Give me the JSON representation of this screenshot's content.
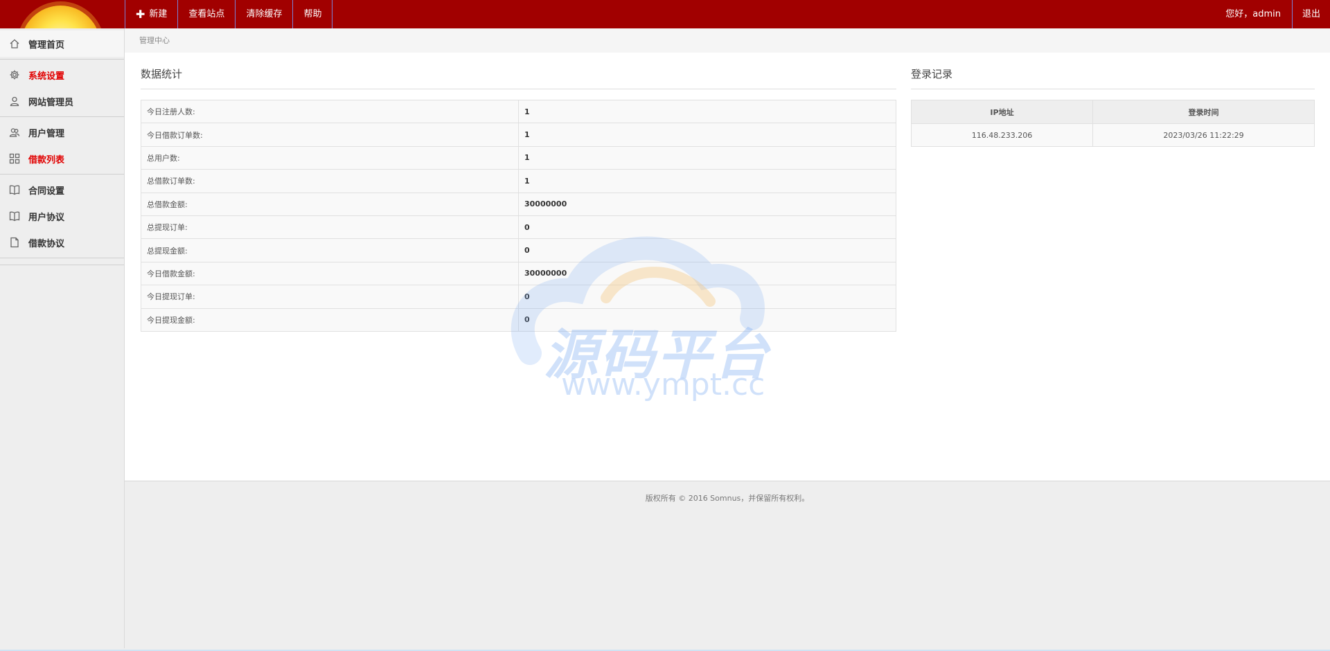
{
  "topnav": {
    "items": [
      {
        "label": "新建",
        "icon": "plus-icon"
      },
      {
        "label": "查看站点"
      },
      {
        "label": "清除缓存"
      },
      {
        "label": "帮助"
      }
    ],
    "greeting": "您好，",
    "username": "admin",
    "logout": "退出"
  },
  "sidebar": {
    "items": [
      {
        "label": "管理首页",
        "icon": "home-icon"
      },
      {
        "label": "系统设置",
        "icon": "gear-icon"
      },
      {
        "label": "网站管理员",
        "icon": "user-icon"
      },
      {
        "label": "用户管理",
        "icon": "users-icon"
      },
      {
        "label": "借款列表",
        "icon": "grid-icon"
      },
      {
        "label": "合同设置",
        "icon": "book-icon"
      },
      {
        "label": "用户协议",
        "icon": "book-icon"
      },
      {
        "label": "借款协议",
        "icon": "document-icon"
      }
    ]
  },
  "breadcrumb": "管理中心",
  "stats": {
    "title": "数据统计",
    "rows": [
      {
        "label": "今日注册人数:",
        "value": "1"
      },
      {
        "label": "今日借款订单数:",
        "value": "1"
      },
      {
        "label": "总用户数:",
        "value": "1"
      },
      {
        "label": "总借款订单数:",
        "value": "1"
      },
      {
        "label": "总借款金额:",
        "value": "30000000"
      },
      {
        "label": "总提现订单:",
        "value": "0"
      },
      {
        "label": "总提现金额:",
        "value": "0"
      },
      {
        "label": "今日借款金额:",
        "value": "30000000"
      },
      {
        "label": "今日提现订单:",
        "value": "0"
      },
      {
        "label": "今日提现金额:",
        "value": "0"
      }
    ]
  },
  "login": {
    "title": "登录记录",
    "headers": [
      "IP地址",
      "登录时间"
    ],
    "rows": [
      {
        "ip": "116.48.233.206",
        "time": "2023/03/26 11:22:29"
      }
    ]
  },
  "footer": "版权所有 © 2016 Somnus，并保留所有权利。",
  "watermark": {
    "text": "源码平台",
    "url": "www.ympt.cc"
  },
  "colors": {
    "topbar": "#a10000",
    "active": "#e10000"
  }
}
